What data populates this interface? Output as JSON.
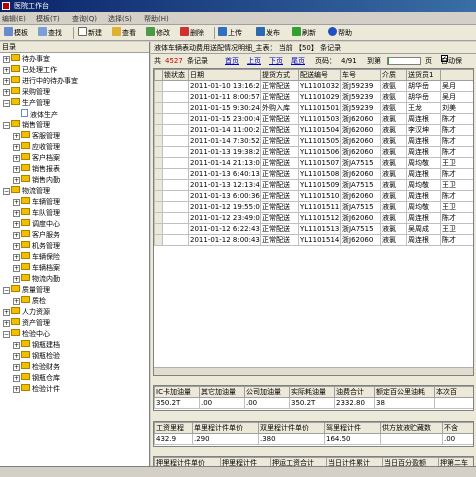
{
  "window": {
    "title": "医院工作台"
  },
  "menu": [
    "编辑(E)",
    "模板(T)",
    "查询(Q)",
    "选择(S)",
    "帮助(H)"
  ],
  "toolbar": {
    "template": "模板",
    "find": "查找",
    "new": "新建",
    "view": "查看",
    "edit": "修改",
    "delete": "删除",
    "upload": "上传",
    "publish": "发布",
    "refresh": "刷新",
    "help": "帮助"
  },
  "sidebar": {
    "header": "目录",
    "items": [
      {
        "label": "待办事宜",
        "level": 0,
        "icon": "folder-icon",
        "expander": "+"
      },
      {
        "label": "已处理工作",
        "level": 0,
        "icon": "folder-icon",
        "expander": "+"
      },
      {
        "label": "进行中的待办事宜",
        "level": 0,
        "icon": "folder-icon",
        "expander": "+"
      },
      {
        "label": "采购管理",
        "level": 0,
        "icon": "folder-icon",
        "expander": "+"
      },
      {
        "label": "生产管理",
        "level": 0,
        "icon": "folder-icon",
        "expander": "-"
      },
      {
        "label": "液体生产",
        "level": 1,
        "icon": "doc-icon",
        "expander": ""
      },
      {
        "label": "销售管理",
        "level": 0,
        "icon": "folder-icon",
        "expander": "-"
      },
      {
        "label": "客服管理",
        "level": 1,
        "icon": "folder-icon",
        "expander": "+"
      },
      {
        "label": "应收管理",
        "level": 1,
        "icon": "folder-icon",
        "expander": "+"
      },
      {
        "label": "客户档案",
        "level": 1,
        "icon": "folder-icon",
        "expander": "+"
      },
      {
        "label": "销售报表",
        "level": 1,
        "icon": "folder-icon",
        "expander": "+"
      },
      {
        "label": "销售内勤",
        "level": 1,
        "icon": "folder-icon",
        "expander": "+"
      },
      {
        "label": "物流管理",
        "level": 0,
        "icon": "folder-icon",
        "expander": "-"
      },
      {
        "label": "车辆管理",
        "level": 1,
        "icon": "folder-icon",
        "expander": "+"
      },
      {
        "label": "车队管理",
        "level": 1,
        "icon": "folder-icon",
        "expander": "+"
      },
      {
        "label": "调度中心",
        "level": 1,
        "icon": "folder-icon",
        "expander": "+"
      },
      {
        "label": "客户服务",
        "level": 1,
        "icon": "folder-icon",
        "expander": "+"
      },
      {
        "label": "机务管理",
        "level": 1,
        "icon": "folder-icon",
        "expander": "+"
      },
      {
        "label": "车辆保险",
        "level": 1,
        "icon": "folder-icon",
        "expander": "+"
      },
      {
        "label": "车辆档案",
        "level": 1,
        "icon": "folder-icon",
        "expander": "+"
      },
      {
        "label": "物流内勤",
        "level": 1,
        "icon": "folder-icon",
        "expander": "+"
      },
      {
        "label": "质量管理",
        "level": 0,
        "icon": "folder-icon",
        "expander": "-"
      },
      {
        "label": "质检",
        "level": 1,
        "icon": "folder-icon",
        "expander": "+"
      },
      {
        "label": "人力资源",
        "level": 0,
        "icon": "folder-icon",
        "expander": "+"
      },
      {
        "label": "资产管理",
        "level": 0,
        "icon": "folder-icon",
        "expander": "+"
      },
      {
        "label": "检验中心",
        "level": 0,
        "icon": "folder-icon",
        "expander": "-"
      },
      {
        "label": "钢瓶建档",
        "level": 1,
        "icon": "folder-icon",
        "expander": "+"
      },
      {
        "label": "钢瓶检验",
        "level": 1,
        "icon": "folder-icon",
        "expander": "+"
      },
      {
        "label": "检验财务",
        "level": 1,
        "icon": "folder-icon",
        "expander": "+"
      },
      {
        "label": "钢瓶仓库",
        "level": 1,
        "icon": "folder-icon",
        "expander": "+"
      },
      {
        "label": "检验计件",
        "level": 1,
        "icon": "folder-icon",
        "expander": "+"
      }
    ]
  },
  "main": {
    "title": "液体车辆表动费用送配情况明细_主表：  当前 【50】 条记录",
    "nav": {
      "total_label": "共",
      "total": "4527",
      "records_label": "条记录",
      "first": "首页",
      "prev": "上页",
      "next": "下页",
      "last": "尾页",
      "page_label": "页码：",
      "page": "4/91",
      "goto_label": "到第",
      "page_suffix": "页",
      "auto_save": "自动保"
    },
    "grid1": {
      "columns": [
        "锁状态",
        "日期",
        "提货方式",
        "配送编号",
        "车号",
        "介质",
        "送货员1",
        ""
      ],
      "rows": [
        [
          "",
          "2011-01-10 13:16:29",
          "正常配送",
          "YL1101032",
          "浙J59239",
          "液氨",
          "胡华岳",
          "吴月"
        ],
        [
          "",
          "2011-01-11 8:00:57",
          "正常配送",
          "YL1101029",
          "浙J59239",
          "液氨",
          "胡华岳",
          "吴月"
        ],
        [
          "",
          "2011-01-15 9:30:24",
          "外购入库",
          "YL1101501",
          "浙J59239",
          "液氨",
          "王龙",
          "刘美"
        ],
        [
          "",
          "2011-01-15 23:00:43",
          "正常配送",
          "YL1101503",
          "浙J62060",
          "液氯",
          "周连根",
          "陈才"
        ],
        [
          "",
          "2011-01-14 11:00:28",
          "正常配送",
          "YL1101504",
          "浙J62060",
          "液氯",
          "李汉坤",
          "陈才"
        ],
        [
          "",
          "2011-01-14 7:30:52",
          "正常配送",
          "YL1101505",
          "浙J62060",
          "液氯",
          "周连根",
          "陈才"
        ],
        [
          "",
          "2011-01-13 19:38:24",
          "正常配送",
          "YL1101506",
          "浙J62060",
          "液氯",
          "周连根",
          "陈才"
        ],
        [
          "",
          "2011-01-14 21:13:03",
          "正常配送",
          "YL1101507",
          "浙JA7515",
          "液氯",
          "周均敬",
          "王卫"
        ],
        [
          "",
          "2011-01-13 6:40:13",
          "正常配送",
          "YL1101508",
          "浙J62060",
          "液氯",
          "周连根",
          "陈才"
        ],
        [
          "",
          "2011-01-13 12:13:44",
          "正常配送",
          "YL1101509",
          "浙JA7515",
          "液氯",
          "周均敬",
          "王卫"
        ],
        [
          "",
          "2011-01-13 6:00:36",
          "正常配送",
          "YL1101510",
          "浙J62060",
          "液氯",
          "周连根",
          "陈才"
        ],
        [
          "",
          "2011-01-12 19:55:06",
          "正常配送",
          "YL1101511",
          "浙JA7515",
          "液氯",
          "周均敬",
          "王卫"
        ],
        [
          "",
          "2011-01-12 23:49:00",
          "正常配送",
          "YL1101512",
          "浙J62060",
          "液氯",
          "周连根",
          "陈才"
        ],
        [
          "",
          "2011-01-12 6:22:43",
          "正常配送",
          "YL1101513",
          "浙JA7515",
          "液氯",
          "吴周成",
          "王卫"
        ],
        [
          "",
          "2011-01-12 8:00:43",
          "正常配送",
          "YL1101514",
          "浙J62060",
          "液氯",
          "周连根",
          "陈才"
        ]
      ]
    },
    "grid2": {
      "columns": [
        "IC卡加油量",
        "其它加油量",
        "公司加油量",
        "实际耗油量",
        "油费合计",
        "额定百公里油耗",
        "本次百"
      ],
      "row": [
        "350.2T",
        ".00",
        ".00",
        "350.2T",
        "2332.80",
        "38",
        ""
      ]
    },
    "grid3": {
      "columns": [
        "工资里程",
        "单里程计件单价",
        "双里程计件单价",
        "驾里程计件",
        "供方放液贮藏数",
        "不含"
      ],
      "row": [
        "432.9",
        ".290",
        ".380",
        "164.50",
        "",
        ".00"
      ]
    },
    "grid4": {
      "columns": [
        "押里程计件单价",
        "押里程计件",
        "押运工资合计",
        "当日计件累计",
        "当日百分盈额",
        "押第二车"
      ]
    }
  }
}
